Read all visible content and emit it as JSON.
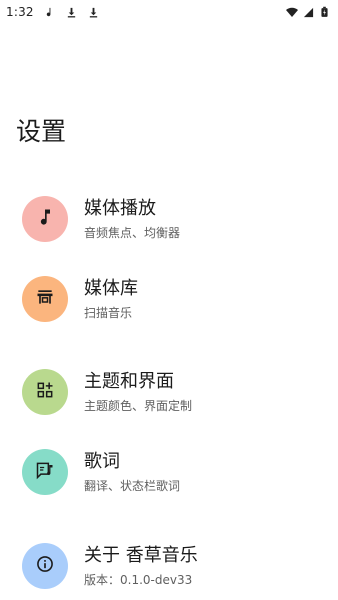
{
  "status_bar": {
    "time": "1:32",
    "icons": [
      "music-note-icon",
      "download-icon",
      "download-icon",
      "wifi-icon",
      "cellular-signal-icon",
      "battery-icon"
    ]
  },
  "page": {
    "title": "设置"
  },
  "items": [
    {
      "title": "媒体播放",
      "subtitle": "音频焦点、均衡器",
      "icon": "music-note-icon",
      "color": "#f8b4ae"
    },
    {
      "title": "媒体库",
      "subtitle": "扫描音乐",
      "icon": "library-icon",
      "color": "#fbb57e"
    },
    {
      "title": "主题和界面",
      "subtitle": "主题颜色、界面定制",
      "icon": "widgets-icon",
      "color": "#b9d98e"
    },
    {
      "title": "歌词",
      "subtitle": "翻译、状态栏歌词",
      "icon": "lyrics-icon",
      "color": "#86dcc8"
    },
    {
      "title": "关于 香草音乐",
      "subtitle": "版本：0.1.0-dev33",
      "icon": "info-icon",
      "color": "#a9cdfb"
    }
  ]
}
